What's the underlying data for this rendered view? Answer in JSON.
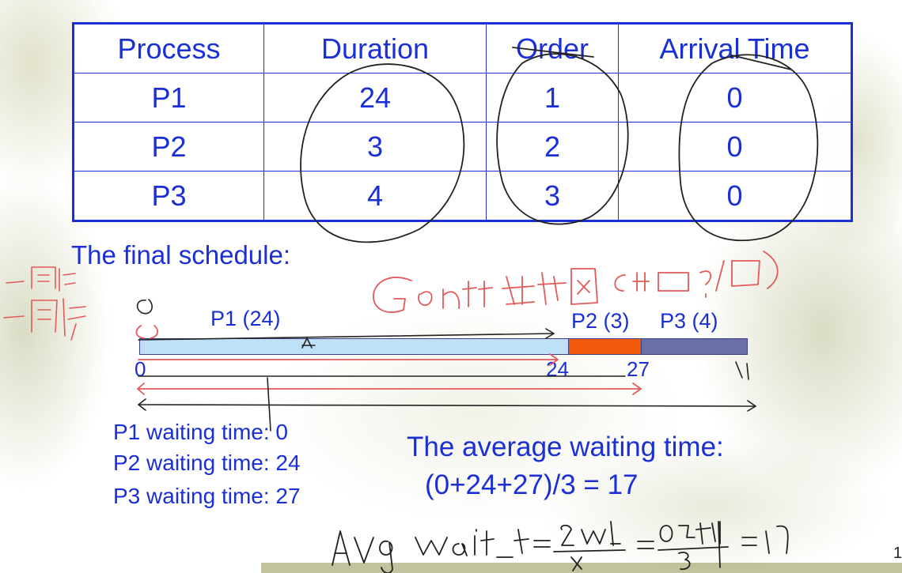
{
  "table": {
    "headers": [
      "Process",
      "Duration",
      "Order",
      "Arrival Time"
    ],
    "rows": [
      [
        "P1",
        "24",
        "1",
        "0"
      ],
      [
        "P2",
        "3",
        "2",
        "0"
      ],
      [
        "P3",
        "4",
        "3",
        "0"
      ]
    ]
  },
  "schedule_heading": "The final schedule:",
  "gantt": {
    "labels": {
      "p1": "P1 (24)",
      "p2": "P2 (3)",
      "p3": "P3 (4)"
    },
    "ticks": [
      "0",
      "24",
      "27"
    ],
    "colors": {
      "p1": "#bfe1f7",
      "p2": "#f05a0a",
      "p3": "#6b6fa8"
    }
  },
  "waiting": {
    "p1": "P1 waiting time: 0",
    "p2": "P2 waiting time: 24",
    "p3": "P3 waiting time: 27"
  },
  "average": {
    "heading": "The average waiting time:",
    "formula": "(0+24+27)/3 = 17"
  },
  "slide_number": "1",
  "colors": {
    "text": "#1a2fd4",
    "annotation_red": "#e25a5a",
    "annotation_black": "#222222"
  }
}
